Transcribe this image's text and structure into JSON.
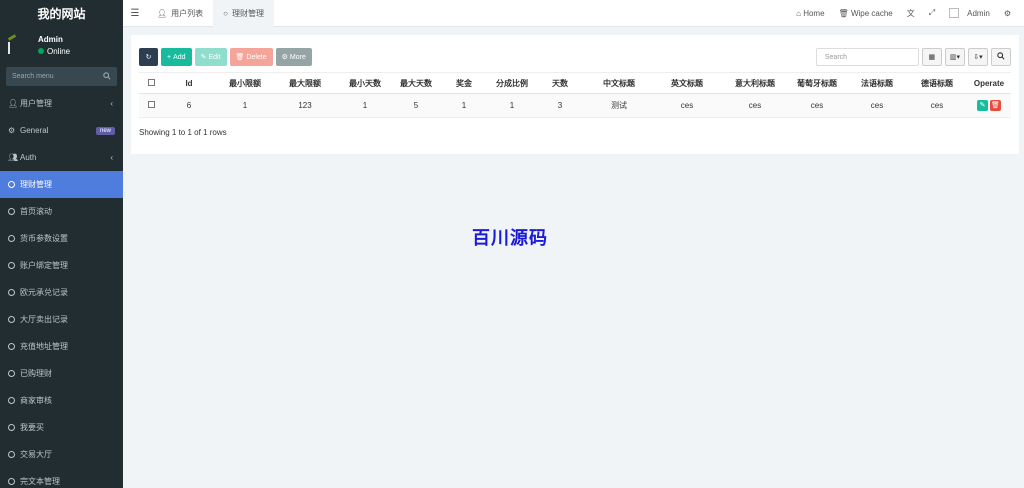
{
  "sidebar": {
    "site_title": "我的网站",
    "user_name": "Admin",
    "user_status": "Online",
    "search_placeholder": "Search menu",
    "items": [
      {
        "label": "用户管理",
        "icon": "user-icon",
        "chevron": "‹"
      },
      {
        "label": "General",
        "icon": "cogs-icon",
        "badge": "new"
      },
      {
        "label": "Auth",
        "icon": "group-icon",
        "chevron": "‹"
      },
      {
        "label": "理财管理",
        "active": true
      },
      {
        "label": "首页滚动"
      },
      {
        "label": "货币参数设置"
      },
      {
        "label": "账户绑定管理"
      },
      {
        "label": "欧元承兑记录"
      },
      {
        "label": "大厅卖出记录"
      },
      {
        "label": "充值地址管理"
      },
      {
        "label": "已购理财"
      },
      {
        "label": "商家审核"
      },
      {
        "label": "我要买"
      },
      {
        "label": "交易大厅"
      },
      {
        "label": "完文本管理"
      }
    ]
  },
  "topbar": {
    "tabs": [
      {
        "label": "用户列表",
        "icon": "user-icon"
      },
      {
        "label": "理财管理",
        "icon": "circle-icon",
        "active": true
      }
    ],
    "home": "Home",
    "wipe_cache": "Wipe cache",
    "admin": "Admin"
  },
  "toolbar": {
    "add": "Add",
    "edit": "Edit",
    "delete": "Delete",
    "more": "More",
    "search_placeholder": "Search"
  },
  "table": {
    "columns": [
      "Id",
      "最小限额",
      "最大限额",
      "最小天数",
      "最大天数",
      "奖金",
      "分成比例",
      "天数",
      "中文标题",
      "英文标题",
      "意大利标题",
      "葡萄牙标题",
      "法语标题",
      "德语标题",
      "Operate"
    ],
    "rows": [
      [
        "6",
        "1",
        "123",
        "1",
        "5",
        "1",
        "1",
        "3",
        "测试",
        "ces",
        "ces",
        "ces",
        "ces",
        "ces"
      ]
    ],
    "footer": "Showing 1 to 1 of 1 rows"
  },
  "watermark": "百川源码",
  "colors": {
    "sidebar_bg": "#222d32",
    "active_menu": "#4e7ddd",
    "add_btn": "#18bc9c",
    "delete_btn": "#e74c3c",
    "watermark": "#1a1adb"
  }
}
